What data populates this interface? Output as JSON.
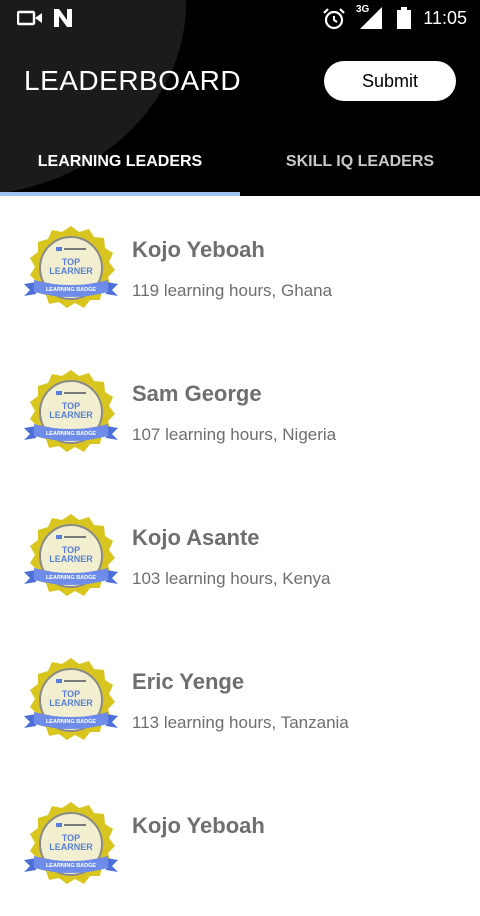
{
  "status_bar": {
    "icons": [
      "video-icon",
      "n-logo-icon",
      "alarm-icon",
      "signal-icon",
      "battery-icon"
    ],
    "network": "3G",
    "time": "11:05"
  },
  "header": {
    "title": "LEADERBOARD",
    "submit_label": "Submit",
    "background_color": "#000000"
  },
  "tabs": [
    {
      "label": "LEARNING LEADERS",
      "active": true
    },
    {
      "label": "SKILL IQ LEADERS",
      "active": false
    }
  ],
  "badge": {
    "line1": "TOP",
    "line2": "LEARNER",
    "ribbon": "LEARNING BADGE"
  },
  "leaders": [
    {
      "name": "Kojo Yeboah",
      "details": "119 learning hours, Ghana"
    },
    {
      "name": "Sam George",
      "details": "107 learning hours, Nigeria"
    },
    {
      "name": "Kojo Asante",
      "details": "103 learning hours, Kenya"
    },
    {
      "name": "Eric Yenge",
      "details": "113 learning hours, Tanzania"
    },
    {
      "name": "Kojo Yeboah",
      "details": ""
    }
  ]
}
